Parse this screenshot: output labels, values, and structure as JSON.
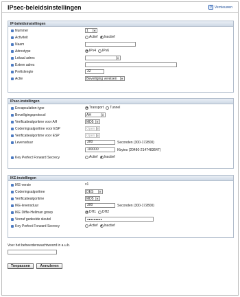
{
  "page": {
    "title": "IPsec-beleidsinstellingen",
    "refresh_label": "Vernieuwen"
  },
  "ip": {
    "header": "IP-beleidsinstellingen",
    "number_label": "Nummer",
    "number_value": "1",
    "active_label": "Activiteit",
    "active_on": "Actief",
    "active_off": "Inactief",
    "name_label": "Naam",
    "name_value": "",
    "addrtype_label": "Adrestype",
    "addrtype_v4": "IPv4",
    "addrtype_v6": "IPv6",
    "local_label": "Lokaal adres",
    "local_value": "",
    "remote_label": "Extern adres",
    "remote_value": "",
    "prefix_label": "Prefixlengte",
    "prefix_value": "32",
    "action_label": "Actie",
    "action_value": "Beveiliging vereisen"
  },
  "ipsec": {
    "header": "IPsec-instellingen",
    "encap_label": "Encapsulation-type",
    "encap_transport": "Transport",
    "encap_tunnel": "Tunnel",
    "protocol_label": "Beveiligingsprotocol",
    "protocol_value": "AH",
    "ah_auth_label": "Verificatiealgoritme voor AH",
    "ah_auth_value": "MD5",
    "esp_enc_label": "Coderingsalgoritme voor ESP",
    "esp_enc_value": "Open",
    "esp_auth_label": "Verificatiealgoritme voor ESP",
    "esp_auth_value": "Open",
    "lifetime_label": "Levensduur",
    "lifetime_sec": "300",
    "lifetime_sec_hint": "Seconden (300-172800)",
    "lifetime_kb": "100000",
    "lifetime_kb_hint": "Kbytes (20480-2147483647)",
    "pfs_label": "Key Perfect Forward Secrecy",
    "pfs_on": "Actief",
    "pfs_off": "Inactief"
  },
  "ike": {
    "header": "IKE-instellingen",
    "version_label": "IKE-versie",
    "version_value": "v1",
    "enc_label": "Coderingsalgoritme",
    "enc_value": "DES",
    "auth_label": "Verificatiealgoritme",
    "auth_value": "MD5",
    "lifetime_label": "IKE-levensduur",
    "lifetime_value": "300",
    "lifetime_hint": "Seconden (300-172800)",
    "dh_label": "IKE Diffie-Hellman groep",
    "dh1": "DH1",
    "dh2": "DH2",
    "psk_label": "Vooraf gedeelde sleutel",
    "psk_value": "●●●●●●●●●",
    "pfs_label": "Key Perfect Forward Secrecy",
    "pfs_on": "Actief",
    "pfs_off": "Inactief"
  },
  "admin": {
    "prompt": "Voer het beheerderswachtwoord in a.u.b.",
    "password_value": ""
  },
  "buttons": {
    "apply": "Toepassen",
    "cancel": "Annuleren"
  },
  "colors": {
    "bullet": "#4d7bc2",
    "section_border": "#b0bccb",
    "link": "#1f4f9a"
  }
}
